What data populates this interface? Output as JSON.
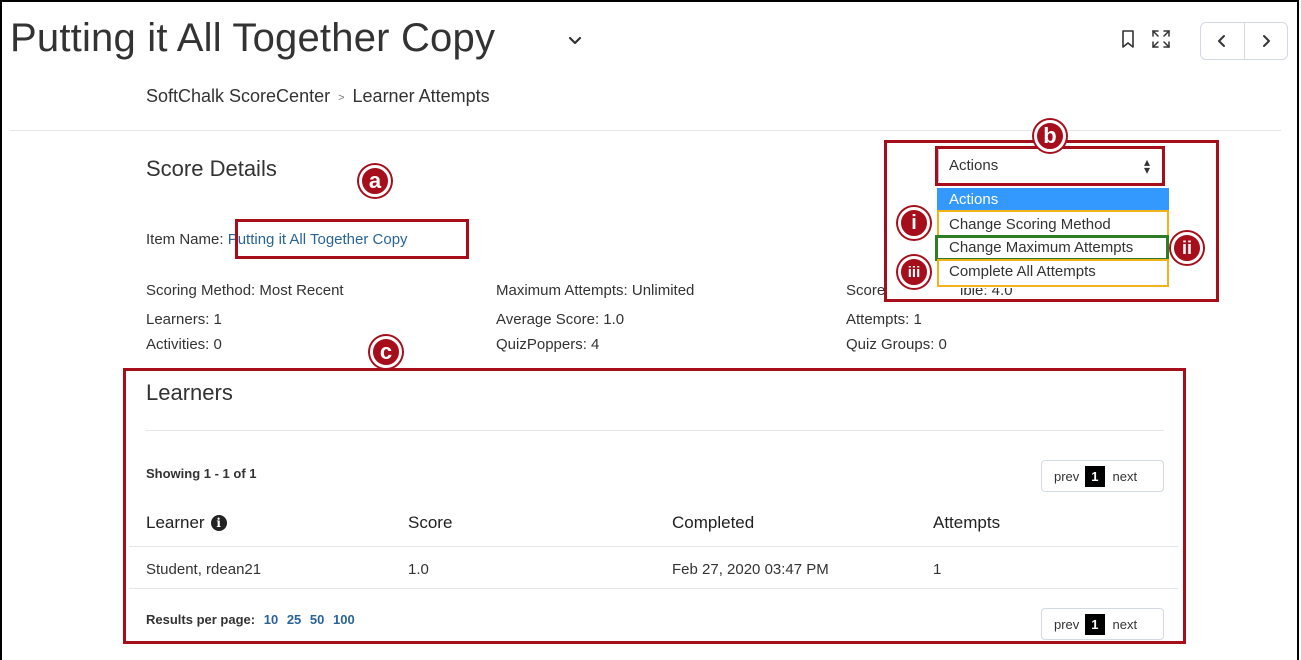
{
  "header": {
    "title": "Putting it All Together Copy",
    "breadcrumb": [
      {
        "label": "SoftChalk ScoreCenter"
      },
      {
        "label": "Learner Attempts"
      }
    ],
    "breadcrumb_separator": ">"
  },
  "score_details": {
    "heading": "Score Details",
    "item_name_label": "Item Name:",
    "item_name_value": "Putting it All Together Copy",
    "stats": {
      "scoring_method": "Scoring Method: Most Recent",
      "learners": "Learners: 1",
      "activities": "Activities:  0",
      "maximum_attempts": "Maximum Attempts: Unlimited",
      "average_score": "Average Score: 1.0",
      "quizpoppers": "QuizPoppers:  4",
      "score_possible_pre": "Score",
      "score_possible_post": "ible: 4.0",
      "attempts": "Attempts: 1",
      "quiz_groups": "Quiz Groups:  0"
    }
  },
  "actions": {
    "selected": "Actions",
    "options": [
      "Actions",
      "Change Scoring Method",
      "Change Maximum Attempts",
      "Complete All Attempts"
    ]
  },
  "callouts": {
    "a": "a",
    "b": "b",
    "c": "c",
    "i": "i",
    "ii": "ii",
    "iii": "iii"
  },
  "learners": {
    "heading": "Learners",
    "showing": "Showing 1 - 1 of 1",
    "pager": {
      "prev": "prev",
      "current": "1",
      "next": "next"
    },
    "columns": {
      "learner": "Learner",
      "score": "Score",
      "completed": "Completed",
      "attempts": "Attempts"
    },
    "info_icon_glyph": "i",
    "rows": [
      {
        "learner": "Student, rdean21",
        "score": "1.0",
        "completed": "Feb 27, 2020 03:47 PM",
        "attempts": "1"
      }
    ],
    "results_per_page_label": "Results per page:",
    "results_per_page_options": [
      "10",
      "25",
      "50",
      "100"
    ]
  },
  "colors": {
    "annotation_red": "#a50e1a",
    "annotation_yellow": "#f2b21a",
    "annotation_green": "#2e7d24",
    "link_blue": "#2a6496",
    "selected_option_blue": "#3399ff"
  },
  "icons": {
    "title": "chevron-down-icon",
    "bookmark": "bookmark-icon",
    "fullscreen": "fullscreen-icon",
    "prev": "chevron-left-icon",
    "next": "chevron-right-icon",
    "info": "info-icon"
  }
}
